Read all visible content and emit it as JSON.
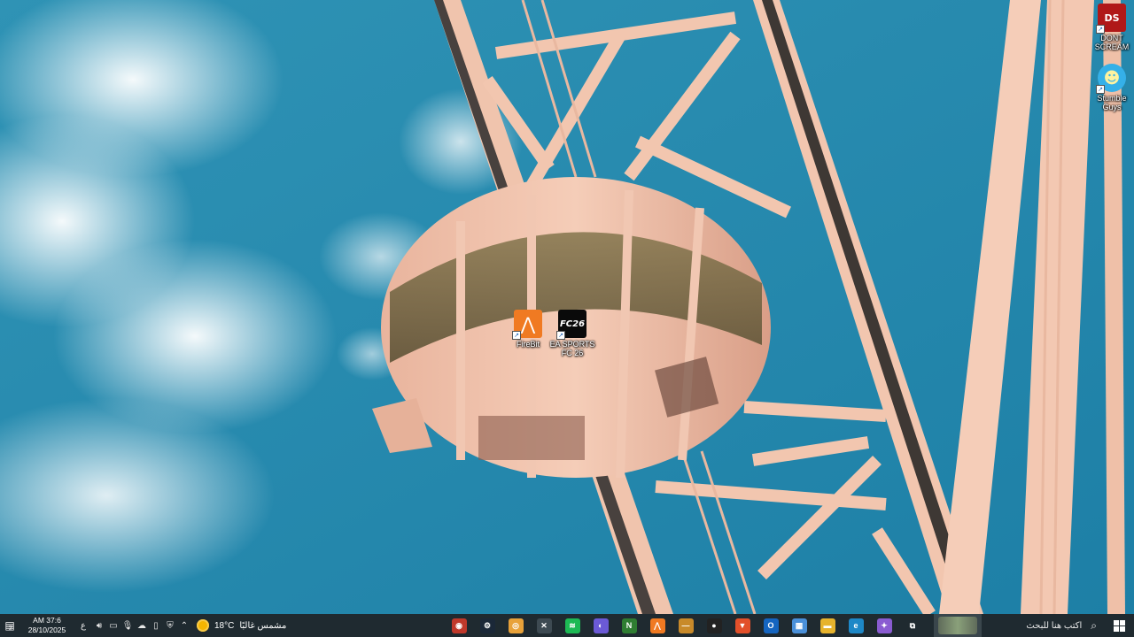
{
  "desktop_icons": [
    {
      "name": "dont-scream",
      "label": "DONT SCREAM",
      "tile_text": "DS",
      "color": "#b01818"
    },
    {
      "name": "stumble-guys",
      "label": "Stumble Guys",
      "tile_text": "☻",
      "color": "#35b0e8"
    },
    {
      "name": "firebit",
      "label": "FireBit",
      "tile_text": "⋀",
      "color": "#f07a22"
    },
    {
      "name": "ea-sports-fc-26",
      "label": "EA SPORTS FC 26",
      "tile_text": "FC26",
      "color": "#0a0a0a"
    }
  ],
  "taskbar": {
    "clock": {
      "time": "AM 37:6",
      "date": "28/10/2025"
    },
    "language": "ع",
    "notification_badge": "2",
    "weather": {
      "temp": "18°C",
      "condition": "مشمس غالبًا"
    },
    "search": {
      "placeholder": "اكتب هنا للبحث"
    },
    "pinned_apps": [
      {
        "name": "media-player",
        "glyph": "◉",
        "color": "#c0392b"
      },
      {
        "name": "steam",
        "glyph": "⚙",
        "color": "#1b2838"
      },
      {
        "name": "chromium",
        "glyph": "◎",
        "color": "#e8a23a"
      },
      {
        "name": "excel-like",
        "glyph": "✕",
        "color": "#3d4a52"
      },
      {
        "name": "spotify",
        "glyph": "≋",
        "color": "#1db954"
      },
      {
        "name": "discord",
        "glyph": "◐",
        "color": "#6b5ad6"
      },
      {
        "name": "nvidia",
        "glyph": "N",
        "color": "#2f7d32"
      },
      {
        "name": "firebit",
        "glyph": "⋀",
        "color": "#f07a22"
      },
      {
        "name": "amd",
        "glyph": "—",
        "color": "#c88a2a"
      },
      {
        "name": "obs",
        "glyph": "●",
        "color": "#222222"
      },
      {
        "name": "brave",
        "glyph": "▼",
        "color": "#e2502a"
      },
      {
        "name": "outlook",
        "glyph": "O",
        "color": "#1565c0"
      },
      {
        "name": "store",
        "glyph": "▦",
        "color": "#4a90d9"
      },
      {
        "name": "file-explorer",
        "glyph": "▬",
        "color": "#e6b32d"
      },
      {
        "name": "edge",
        "glyph": "e",
        "color": "#1e88c7"
      },
      {
        "name": "copilot",
        "glyph": "✦",
        "color": "#8a5cd1"
      },
      {
        "name": "task-view",
        "glyph": "⧉",
        "color": "#1f2a30"
      }
    ]
  }
}
